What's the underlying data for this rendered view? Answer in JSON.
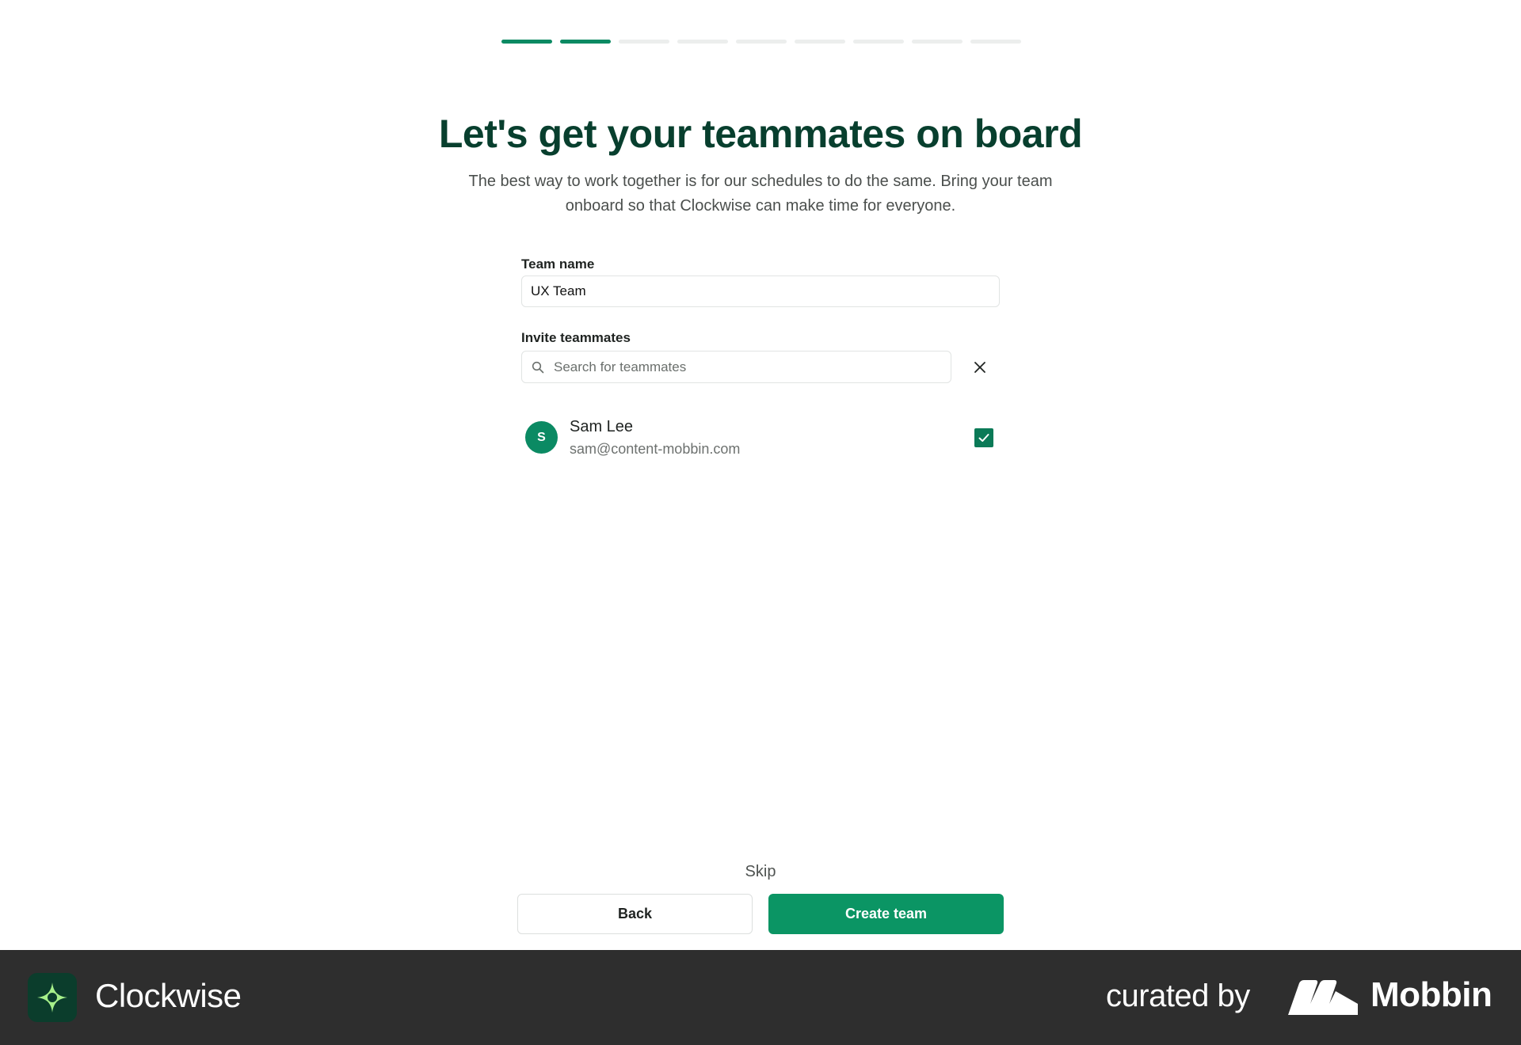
{
  "progress": {
    "total_steps": 9,
    "completed_steps": 2,
    "accent": "#0b8a63"
  },
  "header": {
    "title": "Let's get your teammates on board",
    "subtitle": "The best way to work together is for our schedules to do the same. Bring your team onboard so that Clockwise can make time for everyone."
  },
  "team_name": {
    "label": "Team name",
    "value": "UX Team"
  },
  "invite": {
    "label": "Invite teammates",
    "placeholder": "Search for teammates",
    "search_icon": "search-icon",
    "clear_icon": "close-icon"
  },
  "members": [
    {
      "initial": "S",
      "name": "Sam Lee",
      "email": "sam@content-mobbin.com",
      "checked": true
    }
  ],
  "actions": {
    "skip": "Skip",
    "back": "Back",
    "create": "Create team"
  },
  "footer": {
    "brand": "Clockwise",
    "curated_by": "curated by",
    "curator": "Mobbin"
  },
  "colors": {
    "primary": "#0b9564",
    "title": "#083f2e",
    "footer_bg": "#2e2e2e"
  }
}
